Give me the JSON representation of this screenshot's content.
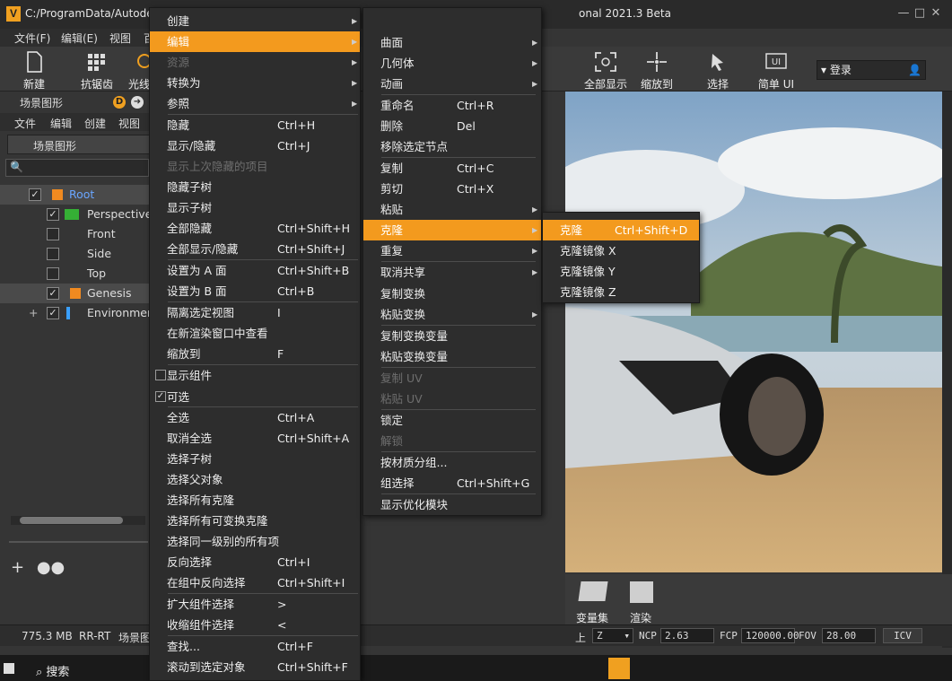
{
  "window": {
    "title_left": "C:/ProgramData/Autode",
    "title_right": "onal 2021.3 Beta",
    "logo": "V"
  },
  "menubar": {
    "items": [
      "文件(F)",
      "编辑(E)",
      "视图",
      "百"
    ]
  },
  "toolbar": {
    "new": "新建",
    "aa": "抗锯齿",
    "raytrace": "光线",
    "showall": "全部显示",
    "zoomto": "缩放到",
    "select": "选择",
    "simple": "简单",
    "ui_suffix": "UI",
    "ui_icon_text": "UI",
    "login": "登录"
  },
  "scene": {
    "title": "场景图形",
    "title2": "场景图形",
    "badge": "D",
    "menu": [
      "文件",
      "编辑",
      "创建",
      "视图"
    ],
    "tree": [
      {
        "label": "Root",
        "checked": true
      },
      {
        "label": "Perspective",
        "checked": true
      },
      {
        "label": "Front",
        "checked": false
      },
      {
        "label": "Side",
        "checked": false
      },
      {
        "label": "Top",
        "checked": false
      },
      {
        "label": "Genesis",
        "checked": true
      },
      {
        "label": "Environment",
        "checked": true
      }
    ]
  },
  "bottom": {
    "variants": "变量集",
    "render": "渲染"
  },
  "status": {
    "memory": "775.3 MB",
    "mode": "RR-RT",
    "scene": "场景图",
    "up": "上",
    "axis": "Z",
    "ncp_label": "NCP",
    "ncp": "2.63",
    "fcp_label": "FCP",
    "fcp": "120000.00",
    "fov_label": "FOV",
    "fov": "28.00",
    "icv": "ICV"
  },
  "taskbar": {
    "search": "搜索"
  },
  "menu1": {
    "items": [
      {
        "label": "创建",
        "shortcut": "",
        "submenu": true
      },
      {
        "label": "编辑",
        "shortcut": "",
        "submenu": true,
        "highlighted": true
      },
      {
        "label": "资源",
        "shortcut": "",
        "submenu": true,
        "disabled": true
      },
      {
        "label": "转换为",
        "shortcut": "",
        "submenu": true
      },
      {
        "label": "参照",
        "shortcut": "",
        "submenu": true
      },
      {
        "label": "隐藏",
        "shortcut": "Ctrl+H"
      },
      {
        "label": "显示/隐藏",
        "shortcut": "Ctrl+J"
      },
      {
        "label": "显示上次隐藏的项目",
        "shortcut": "",
        "disabled": true
      },
      {
        "label": "隐藏子树",
        "shortcut": ""
      },
      {
        "label": "显示子树",
        "shortcut": ""
      },
      {
        "label": "全部隐藏",
        "shortcut": "Ctrl+Shift+H"
      },
      {
        "label": "全部显示/隐藏",
        "shortcut": "Ctrl+Shift+J"
      },
      {
        "label": "设置为 A 面",
        "shortcut": "Ctrl+Shift+B"
      },
      {
        "label": "设置为 B 面",
        "shortcut": "Ctrl+B"
      },
      {
        "label": "隔离选定视图",
        "shortcut": "I"
      },
      {
        "label": "在新渲染窗口中查看",
        "shortcut": ""
      },
      {
        "label": "缩放到",
        "shortcut": "F"
      },
      {
        "label": "显示组件",
        "shortcut": "",
        "checkbox": true,
        "checked": false
      },
      {
        "label": "可选",
        "shortcut": "",
        "checkbox": true,
        "checked": true
      },
      {
        "label": "全选",
        "shortcut": "Ctrl+A"
      },
      {
        "label": "取消全选",
        "shortcut": "Ctrl+Shift+A"
      },
      {
        "label": "选择子树",
        "shortcut": ""
      },
      {
        "label": "选择父对象",
        "shortcut": ""
      },
      {
        "label": "选择所有克隆",
        "shortcut": ""
      },
      {
        "label": "选择所有可变换克隆",
        "shortcut": ""
      },
      {
        "label": "选择同一级别的所有项",
        "shortcut": ""
      },
      {
        "label": "反向选择",
        "shortcut": "Ctrl+I"
      },
      {
        "label": "在组中反向选择",
        "shortcut": "Ctrl+Shift+I"
      },
      {
        "label": "扩大组件选择",
        "shortcut": ">"
      },
      {
        "label": "收缩组件选择",
        "shortcut": "<"
      },
      {
        "label": "查找...",
        "shortcut": "Ctrl+F"
      },
      {
        "label": "滚动到选定对象",
        "shortcut": "Ctrl+Shift+F"
      }
    ]
  },
  "menu2": {
    "items": [
      {
        "label": "曲面",
        "shortcut": "",
        "submenu": true
      },
      {
        "label": "几何体",
        "shortcut": "",
        "submenu": true
      },
      {
        "label": "动画",
        "shortcut": "",
        "submenu": true
      },
      {
        "label": "重命名",
        "shortcut": "Ctrl+R"
      },
      {
        "label": "删除",
        "shortcut": "Del"
      },
      {
        "label": "移除选定节点",
        "shortcut": ""
      },
      {
        "label": "复制",
        "shortcut": "Ctrl+C"
      },
      {
        "label": "剪切",
        "shortcut": "Ctrl+X"
      },
      {
        "label": "粘贴",
        "shortcut": "",
        "submenu": true
      },
      {
        "label": "克隆",
        "shortcut": "",
        "submenu": true,
        "highlighted": true
      },
      {
        "label": "重复",
        "shortcut": "",
        "submenu": true
      },
      {
        "label": "取消共享",
        "shortcut": "",
        "submenu": true
      },
      {
        "label": "复制变换",
        "shortcut": ""
      },
      {
        "label": "粘贴变换",
        "shortcut": "",
        "submenu": true
      },
      {
        "label": "复制变换变量",
        "shortcut": ""
      },
      {
        "label": "粘贴变换变量",
        "shortcut": ""
      },
      {
        "label": "复制 UV",
        "shortcut": "",
        "disabled": true
      },
      {
        "label": "粘贴 UV",
        "shortcut": "",
        "disabled": true
      },
      {
        "label": "锁定",
        "shortcut": ""
      },
      {
        "label": "解锁",
        "shortcut": "",
        "disabled": true
      },
      {
        "label": "按材质分组...",
        "shortcut": ""
      },
      {
        "label": "组选择",
        "shortcut": "Ctrl+Shift+G"
      },
      {
        "label": "显示优化模块",
        "shortcut": ""
      }
    ]
  },
  "menu3": {
    "items": [
      {
        "label": "克隆",
        "shortcut": "Ctrl+Shift+D",
        "highlighted": true
      },
      {
        "label": "克隆镜像 X",
        "shortcut": ""
      },
      {
        "label": "克隆镜像 Y",
        "shortcut": ""
      },
      {
        "label": "克隆镜像 Z",
        "shortcut": ""
      }
    ]
  },
  "colors": {
    "accent": "#f39a1e",
    "menu_bg": "#2d2d2d"
  }
}
